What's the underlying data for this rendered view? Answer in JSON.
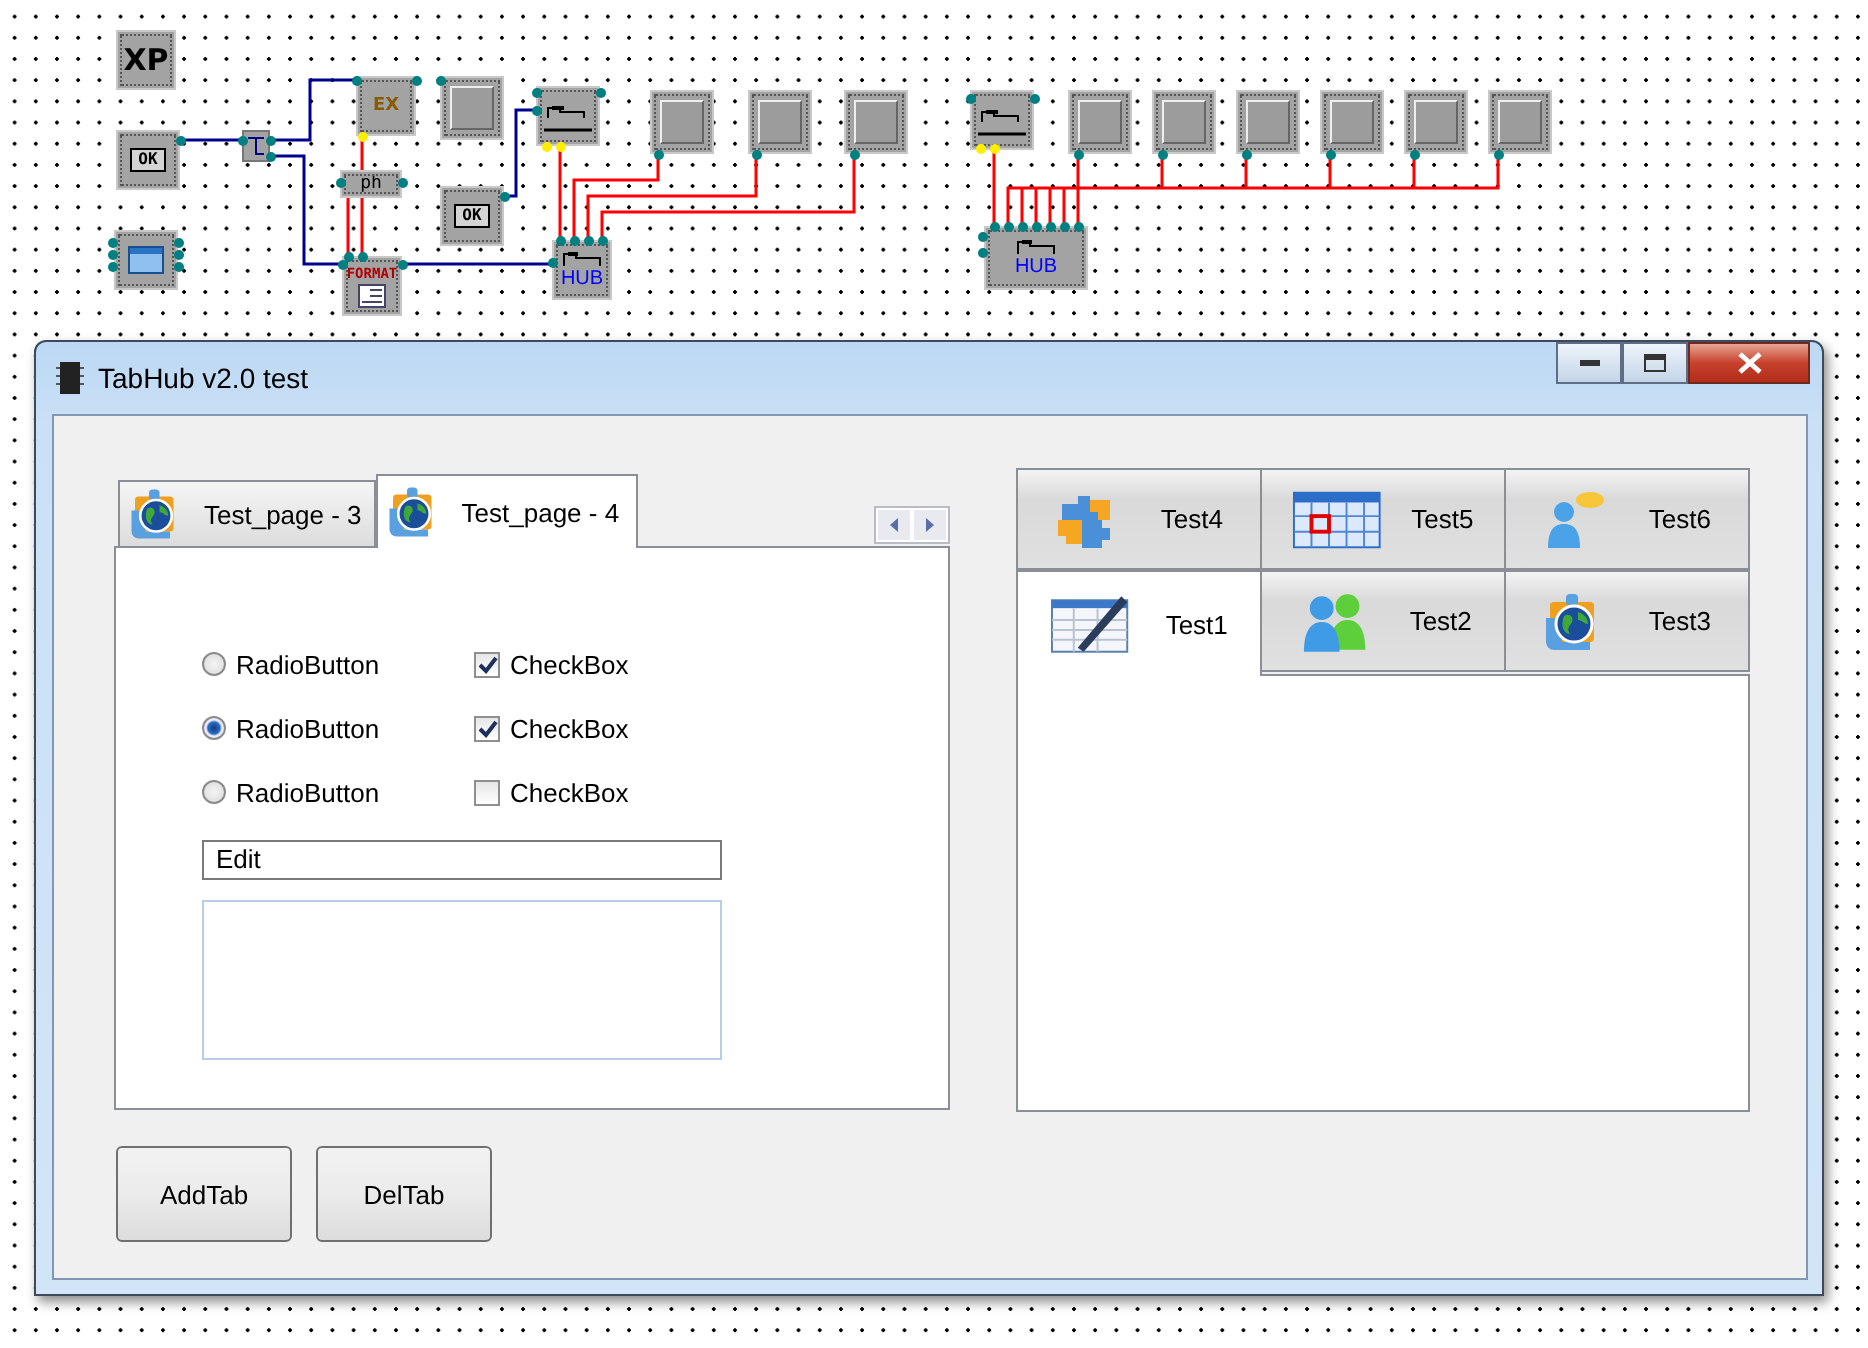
{
  "diagram": {
    "nodes": [
      {
        "kind": "text",
        "text": "XP"
      },
      {
        "kind": "button",
        "text": "OK"
      },
      {
        "kind": "form"
      },
      {
        "kind": "splitter"
      },
      {
        "kind": "counter",
        "text": "EX"
      },
      {
        "kind": "panel"
      },
      {
        "kind": "small",
        "text": "ph"
      },
      {
        "kind": "button",
        "text": "OK"
      },
      {
        "kind": "format",
        "text": "FORMAT"
      },
      {
        "kind": "tabs"
      },
      {
        "kind": "hub",
        "text": "HUB"
      },
      {
        "kind": "panel"
      },
      {
        "kind": "panel"
      },
      {
        "kind": "panel"
      },
      {
        "kind": "tabs"
      },
      {
        "kind": "panel"
      },
      {
        "kind": "panel"
      },
      {
        "kind": "panel"
      },
      {
        "kind": "panel"
      },
      {
        "kind": "panel"
      },
      {
        "kind": "panel"
      },
      {
        "kind": "hub",
        "text": "HUB"
      }
    ]
  },
  "window": {
    "title": "TabHub v2.0 test",
    "left_tabs": [
      {
        "label": "Test_page - 3",
        "selected": false
      },
      {
        "label": "Test_page - 4",
        "selected": true
      }
    ],
    "radios": [
      {
        "label": "RadioButton",
        "selected": false
      },
      {
        "label": "RadioButton",
        "selected": true
      },
      {
        "label": "RadioButton",
        "selected": false
      }
    ],
    "checkboxes": [
      {
        "label": "CheckBox",
        "checked": true
      },
      {
        "label": "CheckBox",
        "checked": true
      },
      {
        "label": "CheckBox",
        "checked": false
      }
    ],
    "edit": {
      "value": "Edit"
    },
    "buttons": [
      "AddTab",
      "DelTab"
    ],
    "right_tab_rows": [
      {
        "tabs": [
          {
            "label": "Test4",
            "selected": false
          },
          {
            "label": "Test5",
            "selected": false
          },
          {
            "label": "Test6",
            "selected": false
          }
        ]
      },
      {
        "tabs": [
          {
            "label": "Test1",
            "selected": true
          },
          {
            "label": "Test2",
            "selected": false
          },
          {
            "label": "Test3",
            "selected": false
          }
        ]
      }
    ]
  }
}
